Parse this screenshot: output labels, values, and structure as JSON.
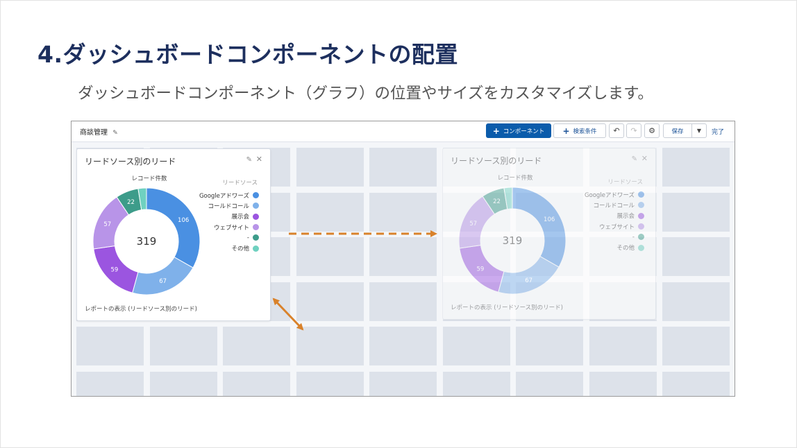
{
  "slide": {
    "title": "4.ダッシュボードコンポーネントの配置",
    "subtitle": "ダッシュボードコンポーネント（グラフ）の位置やサイズをカスタマイズします。"
  },
  "toolbar": {
    "dashboard_name": "商談管理",
    "add_component_label": "コンポーネント",
    "filter_label": "検索条件",
    "save_label": "保存",
    "done_label": "完了"
  },
  "widget": {
    "title": "リードソース別のリード",
    "measure_label": "レコード件数",
    "legend_title": "リードソース",
    "footer_link": "レポートの表示 (リードソース別のリード)",
    "total": "319"
  },
  "colors": {
    "accent": "#0b5cab",
    "title_navy": "#1d2f5e",
    "arrow_orange": "#d9822b",
    "grid_cell": "#dde2ea"
  },
  "icons": [
    "pencil-icon",
    "close-icon",
    "plus-icon",
    "undo-icon",
    "redo-icon",
    "gear-icon",
    "chevron-down-icon"
  ],
  "chart_data": {
    "type": "pie",
    "title": "リードソース別のリード",
    "measure": "レコード件数",
    "legend_title": "リードソース",
    "legend_position": "right",
    "donut": true,
    "total": 319,
    "slices": [
      {
        "name": "Googleアドワーズ",
        "value": 106,
        "color": "#4a90e2"
      },
      {
        "name": "コールドコール",
        "value": 67,
        "color": "#7fb1ea"
      },
      {
        "name": "展示会",
        "value": 59,
        "color": "#9b55e0"
      },
      {
        "name": "ウェブサイト",
        "value": 57,
        "color": "#b894e8"
      },
      {
        "name": "-",
        "value": 22,
        "color": "#3d9c8a"
      },
      {
        "name": "その他",
        "value": 8,
        "color": "#6fd1c0"
      }
    ]
  }
}
